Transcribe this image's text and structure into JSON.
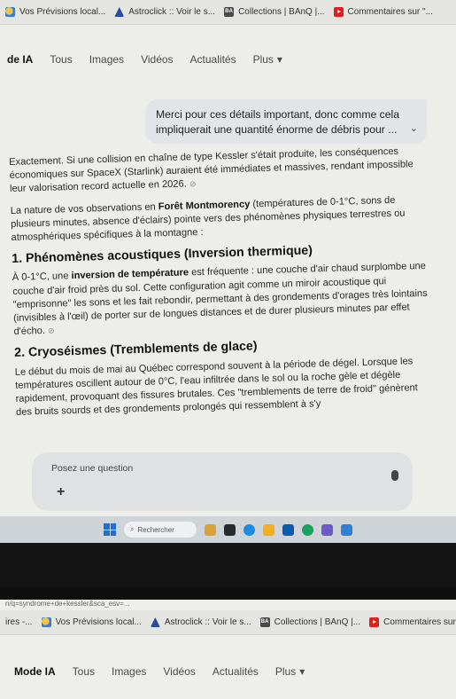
{
  "browser": {
    "bookmarks": [
      {
        "label": "Vos Prévisions local...",
        "icon": "weather-icon"
      },
      {
        "label": "Astroclick :: Voir le s...",
        "icon": "astroclick-icon"
      },
      {
        "label": "Collections | BAnQ |...",
        "icon": "banq-icon"
      },
      {
        "label": "Commentaires sur \"...",
        "icon": "youtube-icon"
      }
    ],
    "bookmarks_bottom_prefix": "ires -...",
    "url_fragment": "n/q=syndrome+de+kessler&sca_esv=..."
  },
  "search_tabs": {
    "active_top": "de IA",
    "active_bottom": "Mode IA",
    "items": [
      "Tous",
      "Images",
      "Vidéos",
      "Actualités",
      "Plus"
    ],
    "more_caret": "▾"
  },
  "conversation": {
    "user_message": "Merci pour ces détails important, donc comme cela impliquerait une quantité énorme de débris pour ...",
    "chevron": "⌄",
    "p1": "Exactement. Si une collision en chaîne de type Kessler s'était produite, les conséquences économiques sur SpaceX (Starlink) auraient été immédiates et massives, rendant impossible leur valorisation record actuelle en 2026.",
    "p2_pre": "La nature de vos observations en ",
    "p2_bold": "Forêt Montmorency",
    "p2_post": " (températures de 0-1°C, sons de plusieurs minutes, absence d'éclairs) pointe vers des phénomènes physiques terrestres ou atmosphériques spécifiques à la montagne :",
    "h1": "1. Phénomènes acoustiques (Inversion thermique)",
    "p3_pre": "À 0-1°C, une ",
    "p3_bold": "inversion de température",
    "p3_post": " est fréquente : une couche d'air chaud surplombe une couche d'air froid près du sol. Cette configuration agit comme un miroir acoustique qui \"emprisonne\" les sons et les fait rebondir, permettant à des grondements d'orages très lointains (invisibles à l'œil) de porter sur de longues distances et de durer plusieurs minutes par effet d'écho.",
    "h2": "2. Cryoséismes (Tremblements de glace)",
    "p4": "Le début du mois de mai au Québec correspond souvent à la période de dégel. Lorsque les températures oscillent autour de 0°C, l'eau infiltrée dans le sol ou la roche gèle et dégèle rapidement, provoquant des fissures brutales. Ces \"tremblements de terre de froid\" génèrent des bruits sourds et des grondements prolongés qui ressemblent à s'y",
    "clip": "⊘"
  },
  "ask": {
    "placeholder": "Posez une question",
    "add": "+"
  },
  "taskbar": {
    "search_label": "Rechercher",
    "accent": "#1f6fd1"
  }
}
